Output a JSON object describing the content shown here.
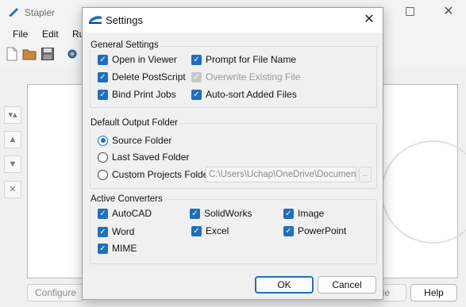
{
  "app": {
    "title": "Stapler",
    "menu": [
      "File",
      "Edit",
      "Ru"
    ],
    "bottom_buttons": {
      "configure": "Configure",
      "staple": "ple",
      "help": "Help"
    }
  },
  "dialog": {
    "title": "Settings",
    "general": {
      "label": "General Settings",
      "options": [
        {
          "label": "Open in Viewer",
          "checked": true,
          "enabled": true
        },
        {
          "label": "Prompt for File Name",
          "checked": true,
          "enabled": true
        },
        {
          "label": "Delete PostScript",
          "checked": true,
          "enabled": true
        },
        {
          "label": "Overwrite Existing File",
          "checked": true,
          "enabled": false
        },
        {
          "label": "Bind Print Jobs",
          "checked": true,
          "enabled": true
        },
        {
          "label": "Auto-sort Added Files",
          "checked": true,
          "enabled": true
        }
      ]
    },
    "output_folder": {
      "label": "Default Output Folder",
      "options": [
        {
          "label": "Source Folder",
          "selected": true
        },
        {
          "label": "Last Saved Folder",
          "selected": false
        },
        {
          "label": "Custom Projects Folder",
          "selected": false
        }
      ],
      "custom_path": "C:\\Users\\Uchap\\OneDrive\\Document",
      "browse_label": ".."
    },
    "converters": {
      "label": "Active Converters",
      "options": [
        {
          "label": "AutoCAD",
          "checked": true
        },
        {
          "label": "SolidWorks",
          "checked": true
        },
        {
          "label": "Image",
          "checked": true
        },
        {
          "label": "Word",
          "checked": true
        },
        {
          "label": "Excel",
          "checked": true
        },
        {
          "label": "PowerPoint",
          "checked": true
        },
        {
          "label": "MIME",
          "checked": true
        }
      ]
    },
    "buttons": {
      "ok": "OK",
      "cancel": "Cancel"
    }
  },
  "icons": {
    "app_logo": "stapler-logo-icon",
    "dialog": "stapler-settings-icon",
    "close": "close-icon",
    "maximize": "maximize-icon",
    "toolbar": [
      "new-file-icon",
      "open-folder-icon",
      "save-icon",
      "settings-gear-icon"
    ],
    "side": [
      "move-top-icon",
      "move-up-icon",
      "move-down-icon",
      "remove-icon"
    ]
  },
  "colors": {
    "accent": "#1f6fbf",
    "disabled": "#c9c9c9"
  }
}
